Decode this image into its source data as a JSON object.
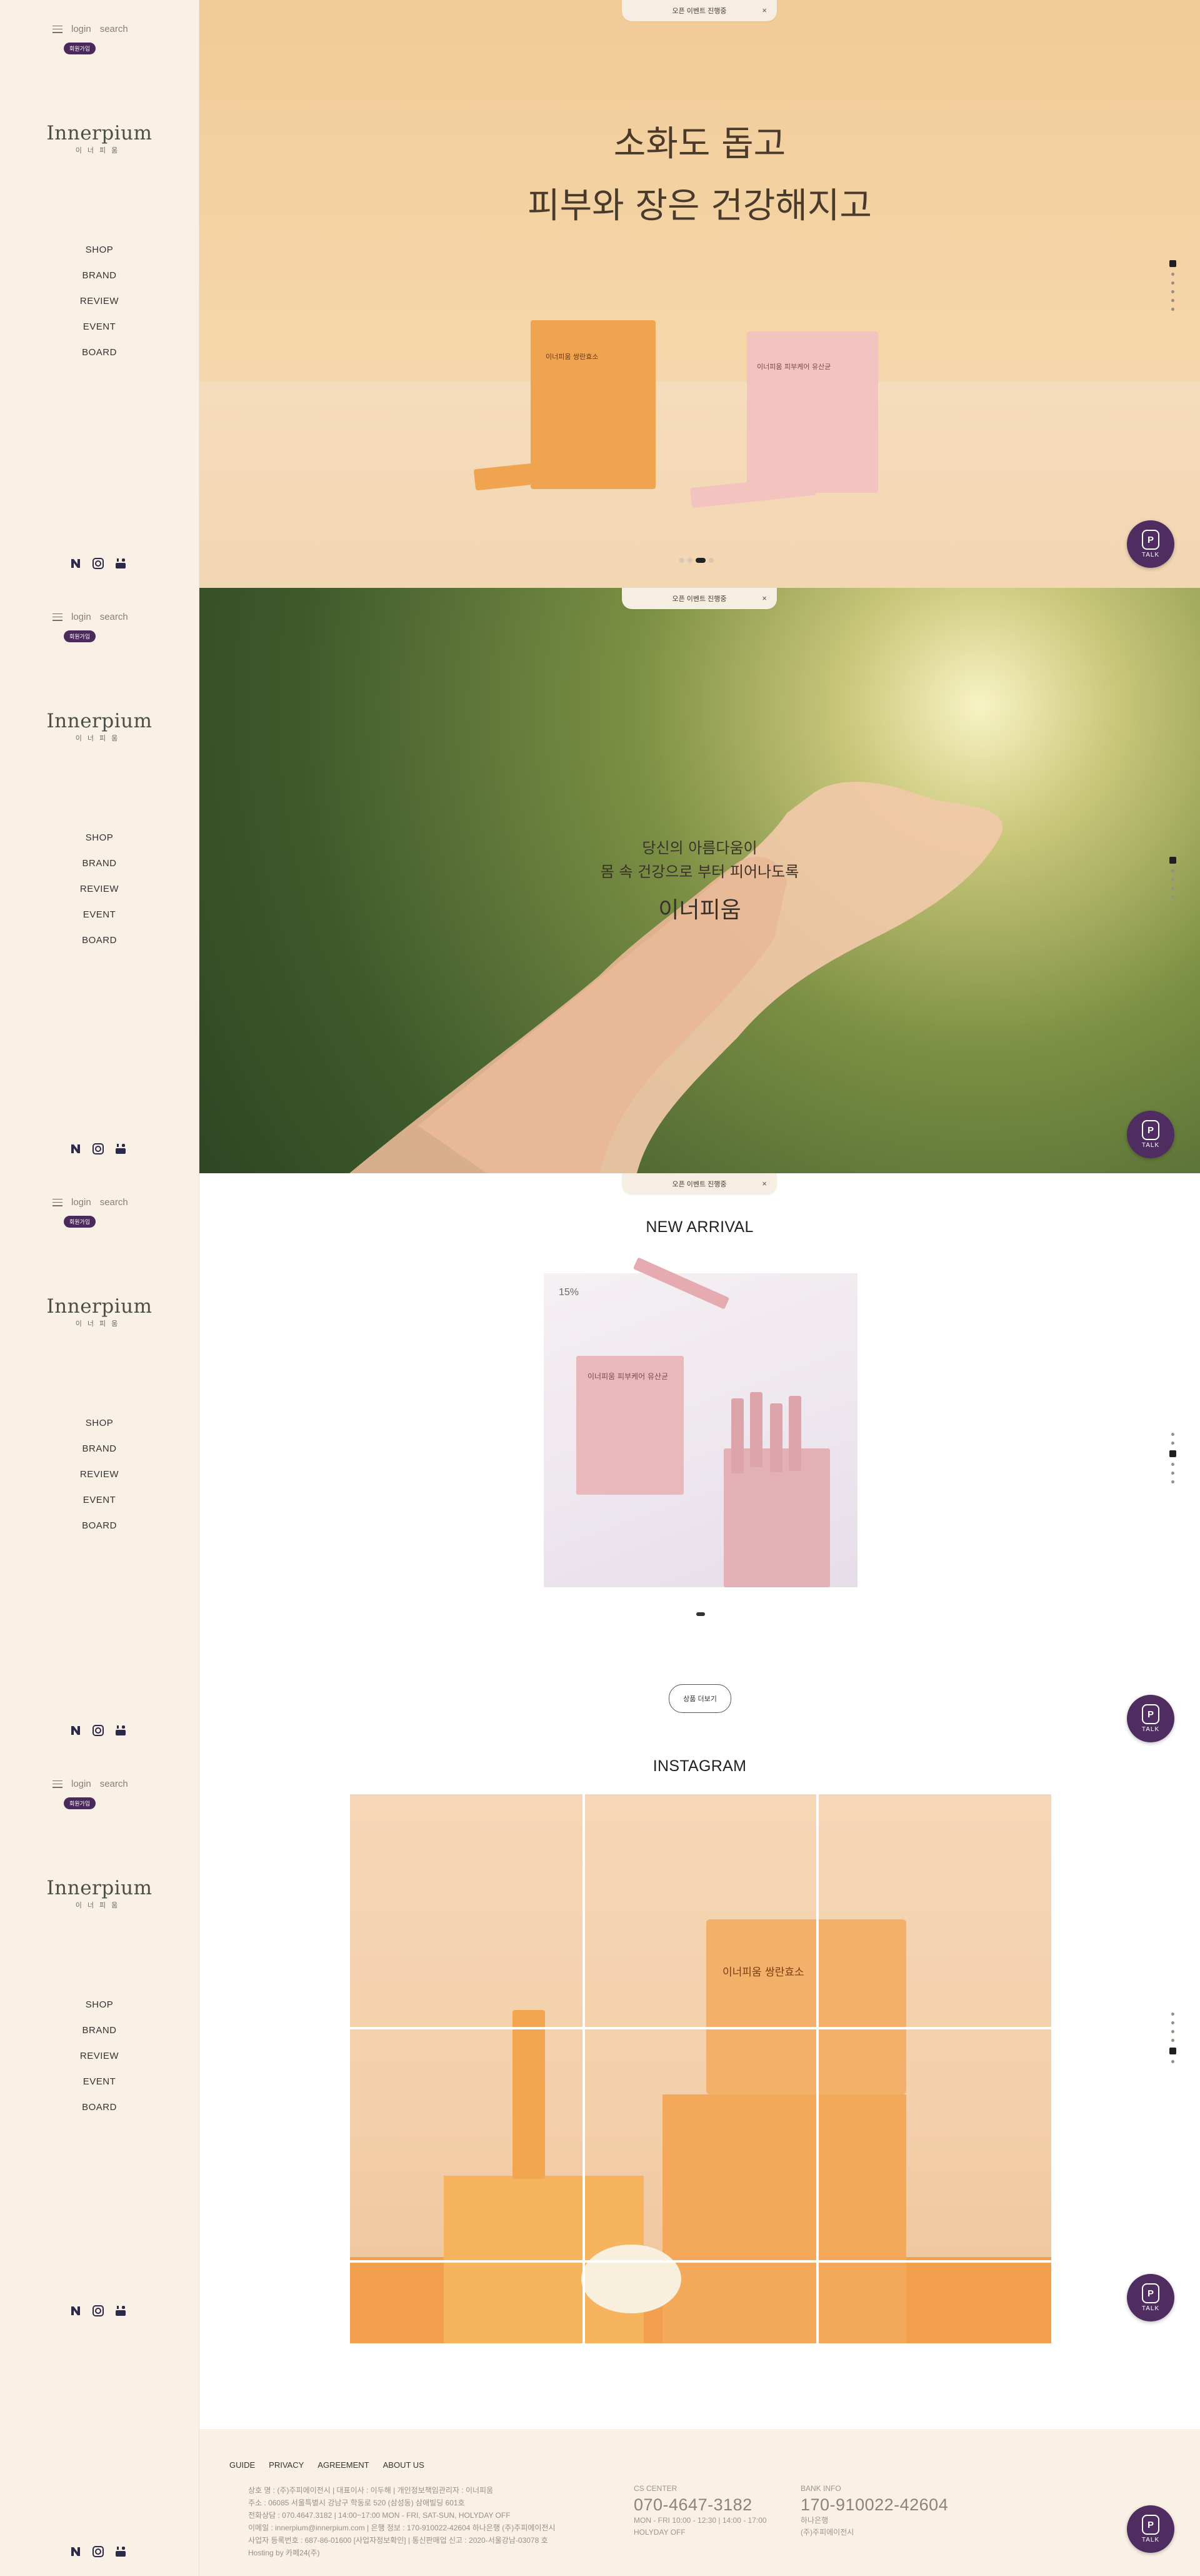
{
  "sidebar": {
    "login": "login",
    "search": "search",
    "join_badge": "회원가입",
    "logo": "Innerpium",
    "logo_sub": "이너피움",
    "menu": [
      "SHOP",
      "BRAND",
      "REVIEW",
      "EVENT",
      "BOARD"
    ],
    "social_icons": [
      "naver-icon",
      "instagram-icon",
      "youtube-icon"
    ]
  },
  "notice": {
    "text": "오픈 이벤트 진행중",
    "close": "×"
  },
  "hero1": {
    "line1": "소화도 돕고",
    "line2": "피부와 장은 건강해지고",
    "box1_label": "이너피움 쌍란효소",
    "box2_label": "이너피움 피부케어 유산균",
    "slide_index": 3,
    "slide_count": 4
  },
  "hero2": {
    "line1": "당신의 아름다움이",
    "line2": "몸 속 건강으로 부터 피어나도록",
    "brand": "이너피움"
  },
  "new_arrival": {
    "title": "NEW ARRIVAL",
    "badge": "15%",
    "product_label": "이너피움 피부케어 유산균",
    "more_button": "상품 더보기"
  },
  "instagram": {
    "title": "INSTAGRAM",
    "product_label": "이너피움 쌍란효소"
  },
  "talk": {
    "label": "TALK"
  },
  "footer": {
    "links": [
      "GUIDE",
      "PRIVACY",
      "AGREEMENT",
      "ABOUT US"
    ],
    "info_lines": [
      "상호 명 : (주)주피에이전시  |  대표이사 : 이두해  |  개인정보책임관리자 : 이너피움",
      "주소 : 06085 서울특별시 강남구 학동로 520 (삼성동) 삼애빌딩 601호",
      "전화상담 : 070.4647.3182  |  14:00~17:00 MON - FRI, SAT-SUN, HOLYDAY OFF",
      "이메일 : innerpium@innerpium.com  |  은행 정보 : 170-910022-42604 하나은행 (주)주피에이전시",
      "사업자 등록번호 : 687-86-01600 [사업자정보확인]  |  통신판매업 신고 : 2020-서울강남-03078 호",
      "Hosting by 카페24(주)"
    ],
    "cs_label": "CS CENTER",
    "cs_phone": "070-4647-3182",
    "cs_hours1": "MON - FRI 10:00 - 12:30  |  14:00 - 17:00",
    "cs_hours2": "HOLYDAY OFF",
    "bank_label": "BANK INFO",
    "bank_number": "170-910022-42604",
    "bank_name": "하나은행",
    "bank_holder": "(주)주피에이전시"
  },
  "colors": {
    "sidebar_bg": "#faf1e6",
    "accent_purple": "#4f2d61",
    "hero1_bg": "#f0cb98"
  }
}
